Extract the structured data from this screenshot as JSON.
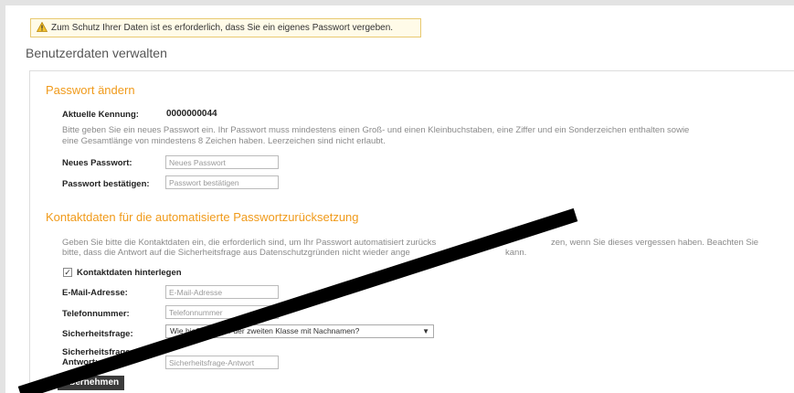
{
  "notice": {
    "text": "Zum Schutz Ihrer Daten ist es erforderlich, dass Sie ein eigenes Passwort vergeben."
  },
  "page_title": "Benutzerdaten verwalten",
  "password_section": {
    "title": "Passwort ändern",
    "current_id_label": "Aktuelle Kennung:",
    "current_id_value": "0000000044",
    "description_line1": "Bitte geben Sie ein neues Passwort ein. Ihr Passwort muss mindestens einen Groß- und einen Kleinbuchstaben, eine Ziffer und ein Sonderzeichen enthalten sowie",
    "description_line2": "eine Gesamtlänge von mindestens 8 Zeichen haben. Leerzeichen sind nicht erlaubt.",
    "new_password_label": "Neues Passwort:",
    "new_password_placeholder": "Neues Passwort",
    "confirm_password_label": "Passwort bestätigen:",
    "confirm_password_placeholder": "Passwort bestätigen"
  },
  "contact_section": {
    "title": "Kontaktdaten für die automatisierte Passwortzurücksetzung",
    "description_line1": "Geben Sie bitte die Kontaktdaten ein, die erforderlich sind, um Ihr Passwort automatisiert zurücks",
    "description_line1b": "zen, wenn Sie dieses vergessen haben. Beachten Sie",
    "description_line2": "bitte, dass die Antwort auf die Sicherheitsfrage aus Datenschutzgründen nicht wieder ange",
    "description_line2b": "kann.",
    "store_contact_label": "Kontaktdaten hinterlegen",
    "store_contact_checked": true,
    "email_label": "E-Mail-Adresse:",
    "email_placeholder": "E-Mail-Adresse",
    "phone_label": "Telefonnummer:",
    "phone_placeholder": "Telefonnummer",
    "question_label": "Sicherheitsfrage:",
    "question_value": "Wie hieß ... lehrer der zweiten Klasse mit Nachnamen?",
    "answer_label_line1": "Sicherheitsfrage",
    "answer_label_line2": "Antwort:",
    "answer_placeholder": "Sicherheitsfrage-Antwort"
  },
  "submit_button": {
    "label": "Übernehmen"
  },
  "colors": {
    "accent": "#f09a1a",
    "warning_border": "#e8c970",
    "button": "#3b3b3b",
    "strike": "#000000"
  }
}
